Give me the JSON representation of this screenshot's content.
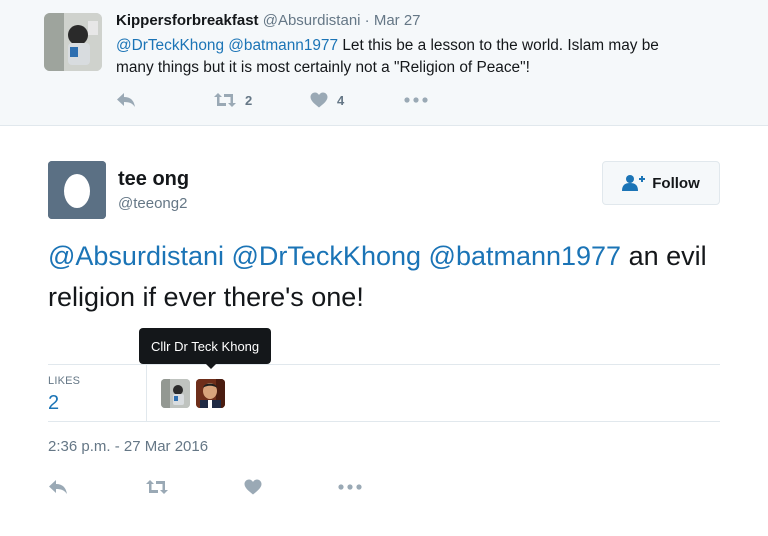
{
  "parent_tweet": {
    "display_name": "Kippersforbreakfast",
    "handle": "@Absurdistani",
    "separator": "·",
    "date": "Mar 27",
    "mentions": [
      "@DrTeckKhong",
      "@batmann1977"
    ],
    "text_line1": " Let this be a lesson to the world. Islam may be",
    "text_line2": "many things but it is most certainly not a \"Religion of Peace\"!",
    "actions": {
      "reply_icon": "reply-icon",
      "retweet_icon": "retweet-icon",
      "retweet_count": "2",
      "like_icon": "heart-icon",
      "like_count": "4",
      "more_icon": "more-icon"
    }
  },
  "main_tweet": {
    "display_name": "tee ong",
    "handle": "@teeong2",
    "follow_button": {
      "label": "Follow",
      "icon": "add-user-icon"
    },
    "mentions": [
      "@Absurdistani",
      "@DrTeckKhong",
      "@batmann1977"
    ],
    "text": " an evil religion if ever there's one!",
    "tooltip": "Cllr Dr Teck Khong",
    "stats": {
      "likes_label": "LIKES",
      "likes_count": "2"
    },
    "timestamp": "2:36 p.m. - 27 Mar 2016",
    "actions": [
      "reply-icon",
      "retweet-icon",
      "heart-icon",
      "more-icon"
    ]
  },
  "colors": {
    "link": "#1b74b6",
    "muted": "#657786",
    "parent_bg": "#f5f8fa",
    "tooltip_bg": "#14171a"
  }
}
